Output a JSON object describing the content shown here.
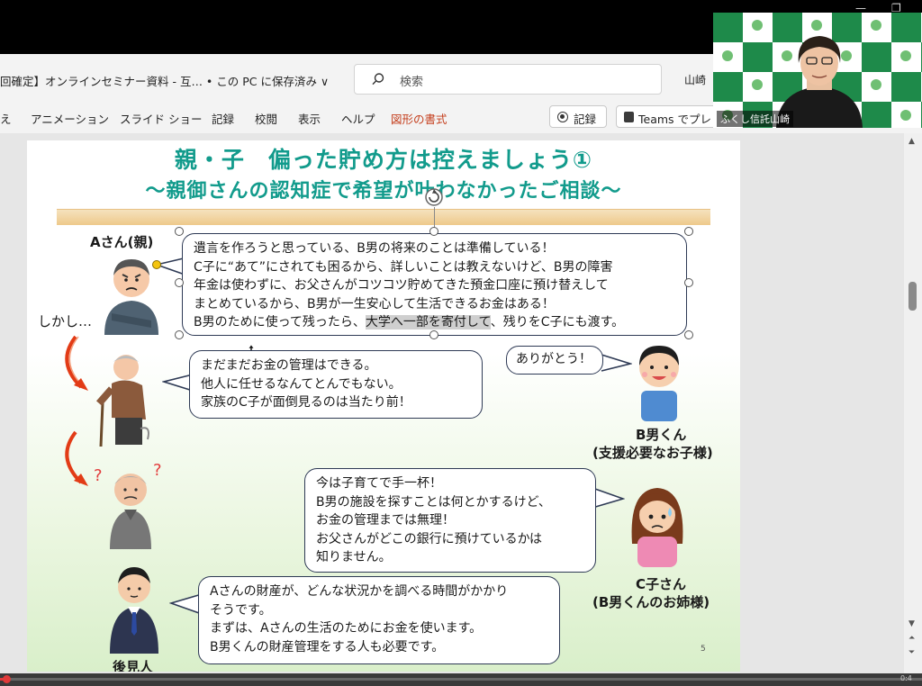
{
  "titlebar": {
    "doc_title": "回確定】オンラインセミナー資料 - 互… • この PC に保存済み ∨",
    "search_placeholder": "検索",
    "user": "山崎"
  },
  "ribbon": {
    "tabs": [
      "え",
      "アニメーション",
      "スライド ショー",
      "記録",
      "校閲",
      "表示",
      "ヘルプ",
      "図形の書式"
    ],
    "record_label": "記録",
    "teams_label": "Teams でプレ"
  },
  "webcam": {
    "name": "ふくし信託山崎"
  },
  "slide": {
    "title": "親・子　偏った貯め方は控えましょう①",
    "subtitle": "～親御さんの認知症で希望が叶わなかったご相談～",
    "labels": {
      "a_parent": "Aさん(親)",
      "however": "しかし…",
      "b_son": "B男くん",
      "b_son_note": "(支援必要なお子様)",
      "c_child": "C子さん",
      "c_child_note": "(B男くんのお姉様)",
      "guardian": "後見人"
    },
    "bubble_a": {
      "line1": "遺言を作ろうと思っている、B男の将来のことは準備している！",
      "line2": "C子に“あて”にされても困るから、詳しいことは教えないけど、B男の障害",
      "line3": "年金は使わずに、お父さんがコツコツ貯めてきた預金口座に預け替えして",
      "line4": "まとめているから、B男が一生安心して生活できるお金はある！",
      "line5_pre": "B男のために使って残ったら、",
      "line5_hl": "大学へ一部を寄付して",
      "line5_post": "、残りをC子にも渡す。"
    },
    "bubble_a2": {
      "line1": "まだまだお金の管理はできる。",
      "line2": "他人に任せるなんてとんでもない。",
      "line3": "家族のC子が面倒見るのは当たり前！"
    },
    "bubble_b": "ありがとう！",
    "bubble_c": {
      "line1": "今は子育てで手一杯！",
      "line2": "B男の施設を探すことは何とかするけど、",
      "line3": "お金の管理までは無理！",
      "line4": "お父さんがどこの銀行に預けているかは",
      "line5": "知りません。"
    },
    "bubble_g": {
      "line1": "Aさんの財産が、どんな状況かを調べる時間がかかり",
      "line2": "そうです。",
      "line3": "まずは、Aさんの生活のためにお金を使います。",
      "line4": "B男くんの財産管理をする人も必要です。"
    },
    "slide_number": "5"
  },
  "video": {
    "progress": 0.005,
    "time": "0:4"
  }
}
